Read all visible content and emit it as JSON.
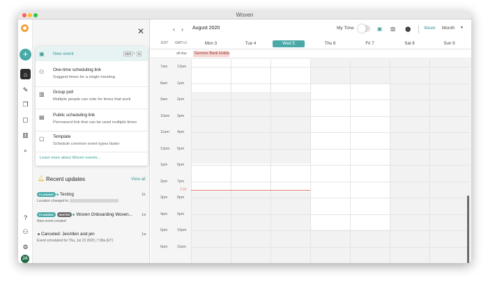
{
  "window": {
    "title": "Woven"
  },
  "iconbar": {
    "items": [
      "home-icon",
      "pencil-icon",
      "copy-icon",
      "calendar-view-icon",
      "chart-icon",
      "search-icon",
      "help-icon",
      "people-icon",
      "gear-icon"
    ],
    "avatar_initials": "JA"
  },
  "menu": {
    "new_event": {
      "label": "New event",
      "shortcut_1": "Shift",
      "shortcut_plus": "+",
      "shortcut_2": "N"
    },
    "items": [
      {
        "title": "One-time scheduling link",
        "subtitle": "Suggest times for a single meeting",
        "icon": "people-icon"
      },
      {
        "title": "Group poll",
        "subtitle": "Multiple people can vote for times that work",
        "icon": "poll-icon"
      },
      {
        "title": "Public scheduling link",
        "subtitle": "Permanent link that can be used multiple times",
        "icon": "calendar-link-icon"
      },
      {
        "title": "Template",
        "subtitle": "Schedule common event types faster",
        "icon": "template-icon"
      }
    ],
    "learn_more": "Learn more about Woven events..."
  },
  "updates": {
    "title": "Recent updates",
    "view_all": "View all",
    "items": [
      {
        "badges": [
          "PLANNING"
        ],
        "name": "Testing",
        "time": "1h",
        "detail": "Location changed to"
      },
      {
        "badges": [
          "PLANNING",
          "INVITED"
        ],
        "name": "Woven Onboarding Woven...",
        "time": "1w",
        "detail": "New event created"
      },
      {
        "badges": [],
        "name": "Canceled: JenAllen and jen",
        "time": "1w",
        "detail": "Event scheduled for Thu, Jul 23 2020, 7:30a (ET)"
      }
    ]
  },
  "calendar": {
    "month": "August 2020",
    "my_time_label": "My Time",
    "view_week": "Week",
    "view_month": "Month",
    "tz_left": "EDT",
    "tz_right": "GMT+1",
    "allday_label": "all-day",
    "holiday": "Summer Bank Holiday",
    "days": [
      "Mon 3",
      "Tue 4",
      "Wed 5",
      "Thu 6",
      "Fri 7",
      "Sat 8",
      "Sun 9"
    ],
    "today_index": 2,
    "hours_left": [
      "7am",
      "8am",
      "9am",
      "10am",
      "11am",
      "12pm",
      "1pm",
      "2pm",
      "3pm",
      "4pm",
      "5pm",
      "6pm"
    ],
    "hours_right": [
      "12pm",
      "1pm",
      "2pm",
      "3pm",
      "4pm",
      "5pm",
      "6pm",
      "7pm",
      "8pm",
      "9pm",
      "10pm",
      "11pm"
    ],
    "now_time": "7:37",
    "colors": {
      "accent": "#4aa9a8",
      "now_line": "#e07a72",
      "holiday_bg": "#f6d5d2"
    }
  }
}
